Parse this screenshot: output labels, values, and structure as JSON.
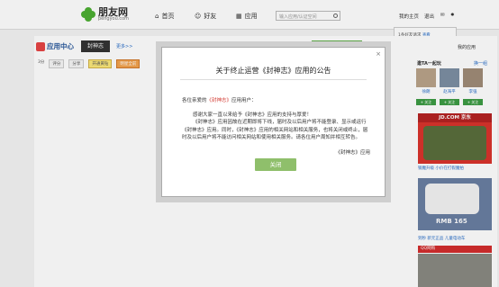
{
  "topnav": {
    "logo_main": "朋友网",
    "logo_sub": "pengyou.com",
    "links": [
      "首页",
      "好友",
      "应用"
    ],
    "search_placeholder": "输入应用/认证空间",
    "right_links": [
      "我的主页",
      "退出"
    ]
  },
  "notification": {
    "line1_prefix": "1条好友请求",
    "line1_link": "查看",
    "line2_prefix": "1条应用消息",
    "line2_link": "查看"
  },
  "app": {
    "center_label": "应用中心",
    "active_tab": "封神志",
    "more": "更多>>",
    "toolbar": [
      "3分",
      "评分",
      "分享",
      "开通黄钻",
      "明星全前"
    ]
  },
  "sidebar": {
    "my_desk": "我的应用",
    "title": "邀TA一起玩",
    "swap": "换一组",
    "names": [
      "徐朗",
      "赵海平",
      "李强"
    ],
    "follow": "+ 关注",
    "ad1_header": "JD.COM 京东",
    "ad1_caption": "钢魔升级 小价在打假魔拍",
    "ad2_rmb": "RMB 165",
    "ad2_caption": "到秒 新元正品 儿童电动车",
    "qq_header": "QQ网购"
  },
  "modal": {
    "title": "关于终止运营《封神志》应用的公告",
    "greeting_prefix": "各位亲爱的",
    "greeting_app": "《封神志》",
    "greeting_suffix": "应用用户：",
    "paragraph1": "感谢大家一直以来给予《封神志》应用的支持与厚爱！",
    "paragraph2": "《封神志》应用因故在近期即将下线，届时及以后用户将不能登录、显示或运行《封神志》应用。同时，《封神志》应用的相关网站和相关服务，也将关闭或终止，届时及以后用户将不能访问相关网站和使用相关服务。请各位用户周知并相互转告。",
    "signature": "《封神志》应用",
    "close_button": "关闭"
  }
}
